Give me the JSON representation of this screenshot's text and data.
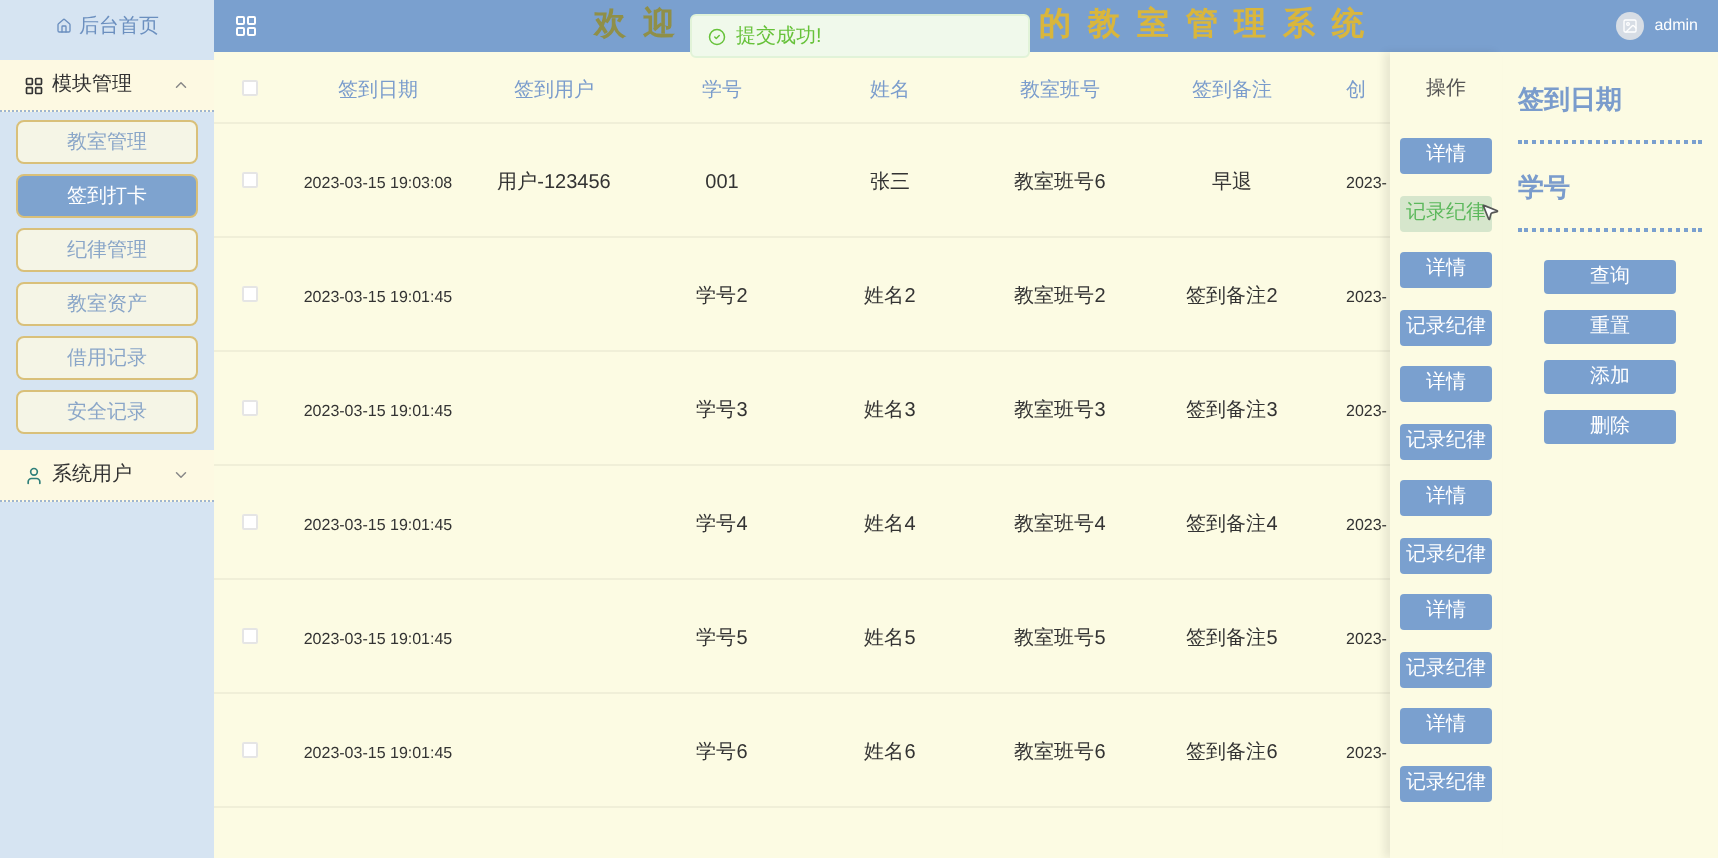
{
  "sidebar": {
    "home": "后台首页",
    "groups": [
      {
        "label": "模块管理",
        "kind": "modules",
        "expanded": true,
        "items": [
          {
            "label": "教室管理",
            "selected": false
          },
          {
            "label": "签到打卡",
            "selected": true
          },
          {
            "label": "纪律管理",
            "selected": false
          },
          {
            "label": "教室资产",
            "selected": false
          },
          {
            "label": "借用记录",
            "selected": false
          },
          {
            "label": "安全记录",
            "selected": false
          }
        ]
      },
      {
        "label": "系统用户",
        "kind": "users",
        "expanded": false
      }
    ]
  },
  "header": {
    "title_start": "欢 迎",
    "title_end": "的 教 室 管 理 系 统",
    "user": "admin"
  },
  "toast": {
    "message": "提交成功!"
  },
  "table": {
    "select_all_checked": false,
    "columns": [
      "签到日期",
      "签到用户",
      "学号",
      "姓名",
      "教室班号",
      "签到备注",
      "创"
    ],
    "actions_header": "操作",
    "rows": [
      {
        "checked": false,
        "cells": [
          "2023-03-15 19:03:08",
          "用户-123456",
          "001",
          "张三",
          "教室班号6",
          "早退",
          "2023-"
        ],
        "actions": [
          {
            "label": "详情",
            "hovered": false
          },
          {
            "label": "记录纪律",
            "hovered": true
          }
        ]
      },
      {
        "checked": false,
        "cells": [
          "2023-03-15 19:01:45",
          "",
          "学号2",
          "姓名2",
          "教室班号2",
          "签到备注2",
          "2023-"
        ],
        "actions": [
          {
            "label": "详情",
            "hovered": false
          },
          {
            "label": "记录纪律",
            "hovered": false
          }
        ]
      },
      {
        "checked": false,
        "cells": [
          "2023-03-15 19:01:45",
          "",
          "学号3",
          "姓名3",
          "教室班号3",
          "签到备注3",
          "2023-"
        ],
        "actions": [
          {
            "label": "详情",
            "hovered": false
          },
          {
            "label": "记录纪律",
            "hovered": false
          }
        ]
      },
      {
        "checked": false,
        "cells": [
          "2023-03-15 19:01:45",
          "",
          "学号4",
          "姓名4",
          "教室班号4",
          "签到备注4",
          "2023-"
        ],
        "actions": [
          {
            "label": "详情",
            "hovered": false
          },
          {
            "label": "记录纪律",
            "hovered": false
          }
        ]
      },
      {
        "checked": false,
        "cells": [
          "2023-03-15 19:01:45",
          "",
          "学号5",
          "姓名5",
          "教室班号5",
          "签到备注5",
          "2023-"
        ],
        "actions": [
          {
            "label": "详情",
            "hovered": false
          },
          {
            "label": "记录纪律",
            "hovered": false
          }
        ]
      },
      {
        "checked": false,
        "cells": [
          "2023-03-15 19:01:45",
          "",
          "学号6",
          "姓名6",
          "教室班号6",
          "签到备注6",
          "2023-"
        ],
        "actions": [
          {
            "label": "详情",
            "hovered": false
          },
          {
            "label": "记录纪律",
            "hovered": false
          }
        ]
      }
    ]
  },
  "search": {
    "fields": [
      "签到日期",
      "学号"
    ],
    "buttons": [
      "查询",
      "重置",
      "添加",
      "删除"
    ]
  }
}
